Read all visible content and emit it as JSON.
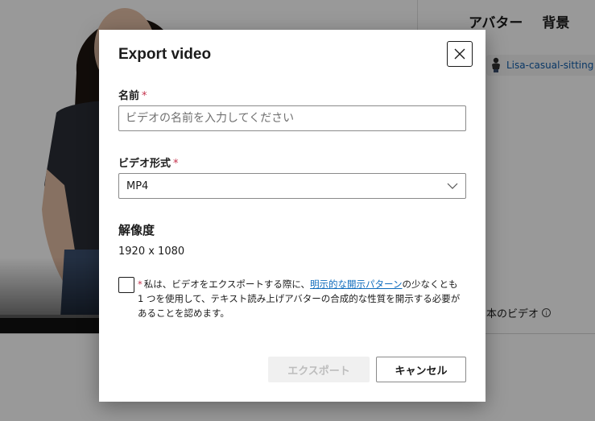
{
  "background": {
    "tabs": [
      {
        "label": "アバター"
      },
      {
        "label": "背景"
      }
    ],
    "avatar_chip_label": "Lisa-casual-sitting",
    "video_count_label": "本のビデオ",
    "info_icon_glyph": "i"
  },
  "dialog": {
    "title": "Export video",
    "name_field": {
      "label": "名前",
      "required_mark": "*",
      "placeholder": "ビデオの名前を入力してください",
      "value": ""
    },
    "format_field": {
      "label": "ビデオ形式",
      "required_mark": "*",
      "selected": "MP4"
    },
    "resolution": {
      "heading": "解像度",
      "value": "1920 x 1080"
    },
    "consent": {
      "required_mark": "*",
      "text_before": "私は、ビデオをエクスポートする際に、",
      "link_text": "明示的な開示パターン",
      "text_after": "の少なくとも 1 つを使用して、テキスト読み上げアバターの合成的な性質を開示する必要があることを認めます。",
      "checked": false
    },
    "buttons": {
      "export_label": "エクスポート",
      "cancel_label": "キャンセル"
    }
  },
  "colors": {
    "overlay": "#000000",
    "required": "#c4314b",
    "link": "#0f6cbd",
    "disabled_bg": "#f0f0f0",
    "disabled_text": "#bdbdbd"
  },
  "icons": {
    "close": "close-icon",
    "chevron": "chevron-down-icon"
  }
}
